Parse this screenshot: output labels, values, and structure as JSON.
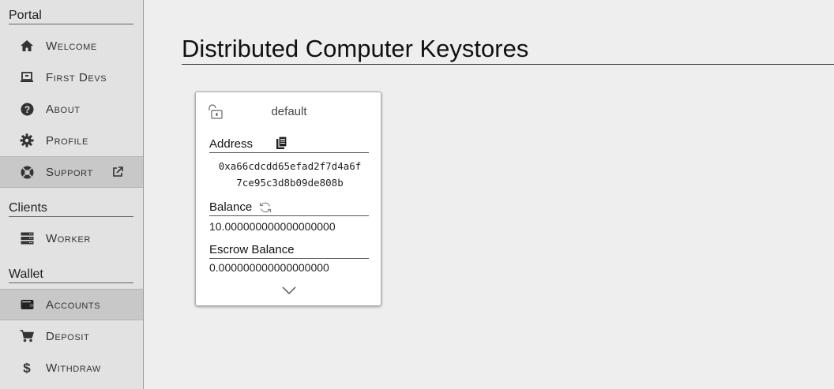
{
  "sidebar": {
    "sections": [
      {
        "title": "Portal"
      },
      {
        "title": "Clients"
      },
      {
        "title": "Wallet"
      }
    ],
    "items": [
      {
        "label": "Welcome",
        "icon": "home-icon"
      },
      {
        "label": "First Devs",
        "icon": "laptop-icon"
      },
      {
        "label": "About",
        "icon": "question-icon"
      },
      {
        "label": "Profile",
        "icon": "gear-icon"
      },
      {
        "label": "Support",
        "icon": "lifebuoy-icon"
      },
      {
        "label": "Worker",
        "icon": "server-icon"
      },
      {
        "label": "Accounts",
        "icon": "wallet-icon"
      },
      {
        "label": "Deposit",
        "icon": "cart-icon"
      },
      {
        "label": "Withdraw",
        "icon": "dollar-icon"
      }
    ]
  },
  "main": {
    "title": "Distributed Computer Keystores",
    "keystore": {
      "name": "default",
      "address_label": "Address",
      "address_line1": "0xa66cdcdd65efad2f7d4a6f",
      "address_line2": "7ce95c3d8b09de808b",
      "balance_label": "Balance",
      "balance": "10.000000000000000000",
      "escrow_label": "Escrow Balance",
      "escrow_balance": "0.000000000000000000"
    }
  },
  "colors": {
    "sidebar_bg": "#e2e2e2",
    "active_bg": "#c8c8c8",
    "page_bg": "#eeeeee"
  }
}
